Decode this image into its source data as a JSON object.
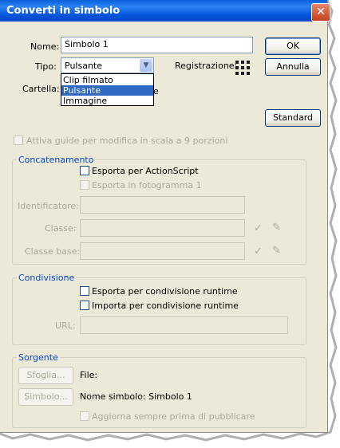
{
  "window": {
    "title": "Converti in simbolo",
    "close_glyph": "✕"
  },
  "form": {
    "nome_label": "Nome:",
    "nome_value": "Simbolo 1",
    "tipo_label": "Tipo:",
    "tipo_value": "Pulsante",
    "tipo_options": [
      "Clip filmato",
      "Pulsante",
      "Immagine"
    ],
    "cartella_label": "Cartella:",
    "cartella_partial": "e",
    "registrazione_label": "Registrazione:"
  },
  "buttons": {
    "ok": "OK",
    "annulla": "Annulla",
    "standard": "Standard"
  },
  "guides_checkbox": "Attiva guide per modifica in scala a 9 porzioni",
  "concatenamento": {
    "title": "Concatenamento",
    "esporta_as": "Esporta per ActionScript",
    "esporta_frame": "Esporta in fotogramma 1",
    "identificatore_label": "Identificatore:",
    "classe_label": "Classe:",
    "classe_base_label": "Classe base:",
    "check_icon": "✓",
    "pencil_icon": "✎"
  },
  "condivisione": {
    "title": "Condivisione",
    "esporta_runtime": "Esporta per condivisione runtime",
    "importa_runtime": "Importa per condivisione runtime",
    "url_label": "URL:"
  },
  "sorgente": {
    "title": "Sorgente",
    "sfoglia_button": "Sfoglia...",
    "file_label": "File:",
    "simbolo_button": "Simbolo...",
    "nome_simbolo": "Nome simbolo: Simbolo 1",
    "aggiorna": "Aggiorna sempre prima di pubblicare"
  },
  "colors": {
    "title_bar": "#0a5fd8",
    "group_title": "#0046d5",
    "dialog_bg": "#ece9d8",
    "selection": "#316ac5"
  }
}
